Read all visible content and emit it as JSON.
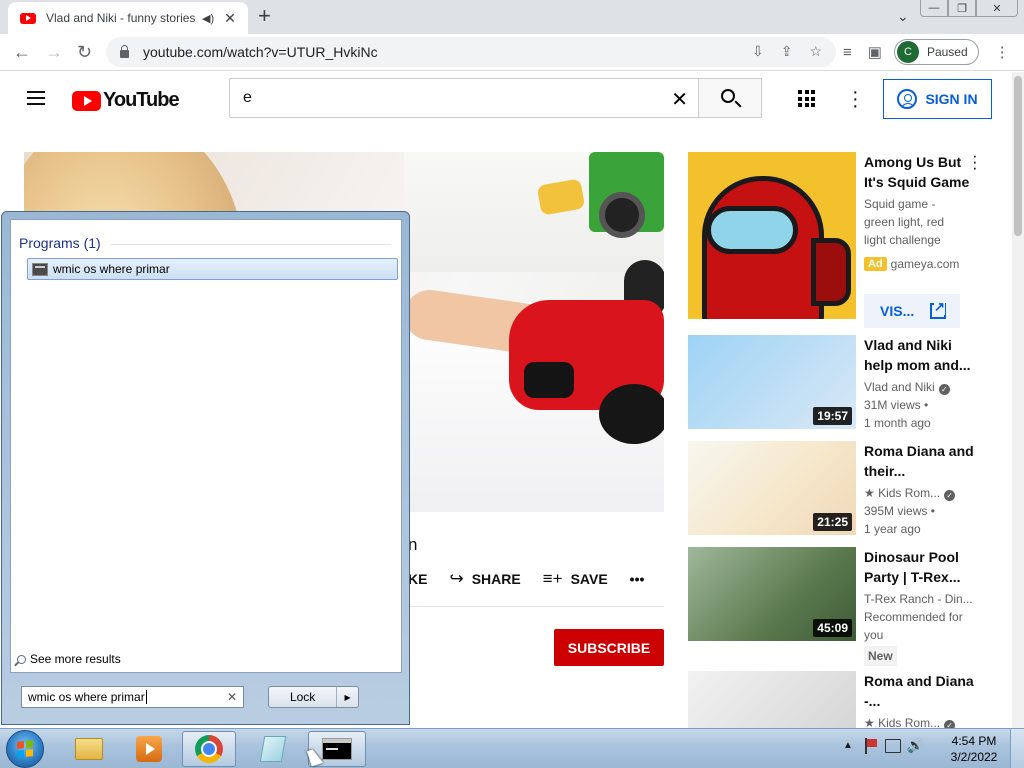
{
  "browser": {
    "tab": {
      "title": "Vlad and Niki - funny stories",
      "audio_icon": "speaker-icon"
    },
    "new_tab_icon": "plus-icon",
    "window_controls": [
      "minimize",
      "restore",
      "close"
    ],
    "url": "youtube.com/watch?v=UTUR_HvkiNc",
    "profile": {
      "initial": "C",
      "status": "Paused"
    }
  },
  "youtube": {
    "logo_text": "YouTube",
    "search": {
      "value": "e"
    },
    "signin_label": "SIGN IN",
    "video": {
      "title_visible_fragment": "n",
      "actions": {
        "like_fragment": "KE",
        "share": "SHARE",
        "save": "SAVE"
      },
      "subscribe_label": "SUBSCRIBE"
    },
    "ad": {
      "title": "Among Us But It's Squid Game",
      "description": "Squid game - green light, red light challenge",
      "badge": "Ad",
      "domain": "gameya.com",
      "visit_label": "VIS..."
    },
    "recommendations": [
      {
        "title": "Vlad and Niki help mom and...",
        "channel": "Vlad and Niki",
        "verified": true,
        "views": "31M views",
        "age": "1 month ago",
        "duration": "19:57"
      },
      {
        "title": "Roma Diana and their...",
        "channel": "★ Kids Rom...",
        "verified": true,
        "views": "395M views",
        "age": "1 year ago",
        "duration": "21:25"
      },
      {
        "title": "Dinosaur Pool Party | T-Rex...",
        "channel": "T-Rex Ranch - Din...",
        "verified": false,
        "views": "Recommended for you",
        "age": "",
        "badge": "New",
        "duration": "45:09"
      },
      {
        "title": "Roma and Diana -...",
        "channel": "★ Kids Rom...",
        "verified": true,
        "views": "",
        "age": "",
        "duration": ""
      }
    ]
  },
  "startmenu": {
    "programs_header": "Programs (1)",
    "result": "wmic os where primar",
    "see_more": "See more results",
    "search_value": "wmic os where primar",
    "lock_label": "Lock"
  },
  "taskbar": {
    "pinned": [
      "explorer-icon",
      "media-player-icon",
      "chrome-icon",
      "notes-icon",
      "cmd-icon"
    ],
    "clock": {
      "time": "4:54 PM",
      "date": "3/2/2022"
    }
  }
}
